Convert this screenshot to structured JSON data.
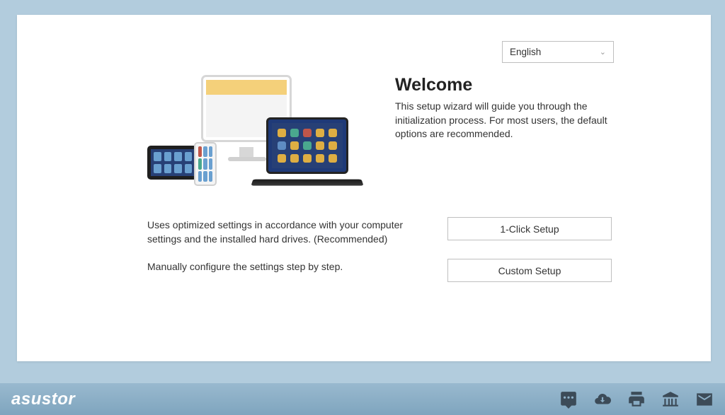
{
  "language": {
    "selected": "English"
  },
  "welcome": {
    "title": "Welcome",
    "description": "This setup wizard will guide you through the initialization process. For most users, the default options are recommended."
  },
  "options": {
    "oneClick": {
      "description": "Uses optimized settings in accordance with your computer settings and the installed hard drives. (Recommended)",
      "button": "1-Click Setup"
    },
    "custom": {
      "description": "Manually configure the settings step by step.",
      "button": "Custom Setup"
    }
  },
  "footer": {
    "brand": "asustor"
  }
}
